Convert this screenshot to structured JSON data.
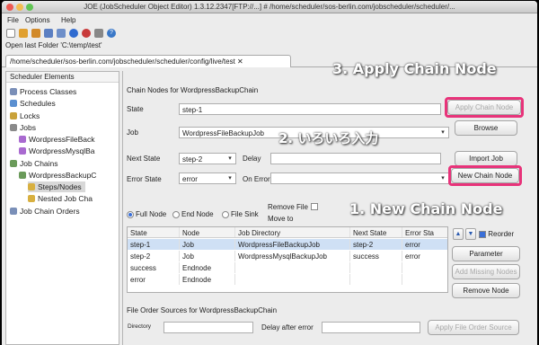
{
  "window": {
    "title": "JOE (JobScheduler Object Editor) 1.3.12.2347[FTP://...] # /home/scheduler/sos-berlin.com/jobscheduler/scheduler/...",
    "menu": [
      "File",
      "Options",
      "Help"
    ],
    "open_last": "Open last Folder 'C:\\temp\\test'",
    "tab_label": "/home/scheduler/sos-berlin.com/jobscheduler/scheduler/config/live/test"
  },
  "sidebar": {
    "title": "Scheduler Elements",
    "items": [
      {
        "label": "Process Classes",
        "icon": "gear-icon"
      },
      {
        "label": "Schedules",
        "icon": "calendar-icon"
      },
      {
        "label": "Locks",
        "icon": "lock-icon"
      },
      {
        "label": "Jobs",
        "icon": "jobs-icon"
      },
      {
        "label": "WordpressFileBack",
        "icon": "job-icon"
      },
      {
        "label": "WordpressMysqlBa",
        "icon": "job-icon"
      },
      {
        "label": "Job Chains",
        "icon": "chain-icon"
      },
      {
        "label": "WordpressBackupC",
        "icon": "chain-icon"
      },
      {
        "label": "Steps/Nodes",
        "icon": "folder-icon"
      },
      {
        "label": "Nested Job Cha",
        "icon": "folder-icon"
      },
      {
        "label": "Job Chain Orders",
        "icon": "orders-icon"
      }
    ]
  },
  "form": {
    "section_title": "Chain Nodes for WordpressBackupChain",
    "state_label": "State",
    "state_value": "step-1",
    "job_label": "Job",
    "job_value": "WordpressFileBackupJob",
    "next_state_label": "Next State",
    "next_state_value": "step-2",
    "delay_label": "Delay",
    "error_state_label": "Error State",
    "error_state_value": "error",
    "on_error_label": "On Error",
    "remove_file_label": "Remove File",
    "move_to_label": "Move to",
    "radios": [
      "Full Node",
      "End Node",
      "File Sink"
    ],
    "reorder_label": "Reorder"
  },
  "buttons": {
    "apply_chain_node": "Apply Chain Node",
    "browse": "Browse",
    "import_job": "Import Job",
    "new_chain_node": "New Chain Node",
    "parameter": "Parameter",
    "add_missing_nodes": "Add Missing Nodes",
    "remove_node": "Remove Node",
    "apply_file_order_source": "Apply File Order Source"
  },
  "table": {
    "columns": [
      "State",
      "Node",
      "Job Directory",
      "Next State",
      "Error Sta"
    ],
    "rows": [
      [
        "step-1",
        "Job",
        "WordpressFileBackupJob",
        "step-2",
        "error"
      ],
      [
        "step-2",
        "Job",
        "WordpressMysqlBackupJob",
        "success",
        "error"
      ],
      [
        "success",
        "Endnode",
        "",
        "",
        ""
      ],
      [
        "error",
        "Endnode",
        "",
        "",
        ""
      ]
    ]
  },
  "file_order": {
    "title": "File Order Sources for WordpressBackupChain",
    "directory_label": "Directory",
    "delay_after_error_label": "Delay after error"
  },
  "annotations": {
    "step3": "3. Apply Chain Node",
    "step2": "2. いろいろ入力",
    "step1": "1. New Chain Node",
    "color": "#e8337a"
  }
}
